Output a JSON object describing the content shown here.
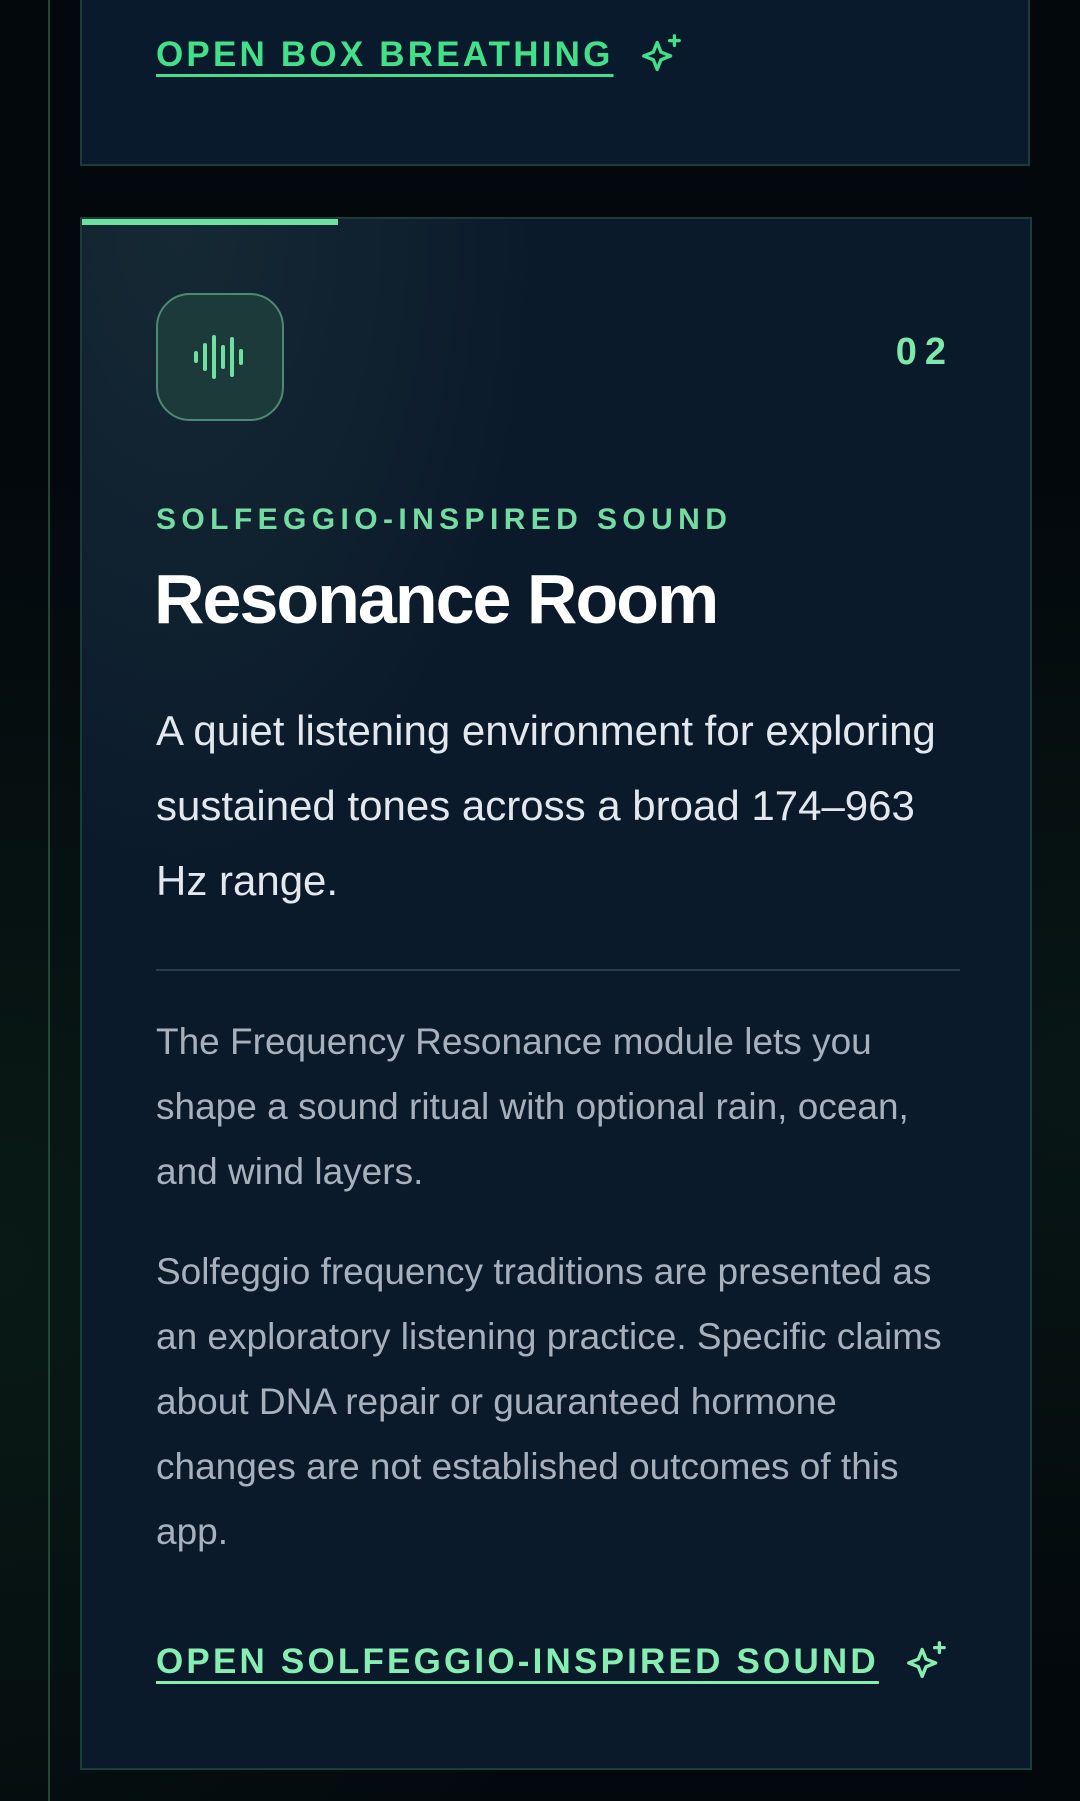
{
  "colors": {
    "accent": "#43e08a",
    "accent_soft": "#7ee8a8",
    "card_background": "#0b1a2b",
    "page_background": "#03080c"
  },
  "previous_card": {
    "cta_label": "OPEN BOX BREATHING",
    "cta_icon": "sparkle-icon"
  },
  "card": {
    "progress": 0.27,
    "icon": "sound-wave-icon",
    "index": "02",
    "eyebrow": "SOLFEGGIO-INSPIRED SOUND",
    "title": "Resonance Room",
    "lead": "A quiet listening environment for exploring sustained tones across a broad 174–963 Hz range.",
    "body": [
      "The Frequency Resonance module lets you shape a sound ritual with optional rain, ocean, and wind layers.",
      "Solfeggio frequency traditions are presented as an exploratory listening practice. Specific claims about DNA repair or guaranteed hormone changes are not established outcomes of this app."
    ],
    "cta_label": "OPEN SOLFEGGIO-INSPIRED SOUND",
    "cta_icon": "sparkle-icon"
  }
}
